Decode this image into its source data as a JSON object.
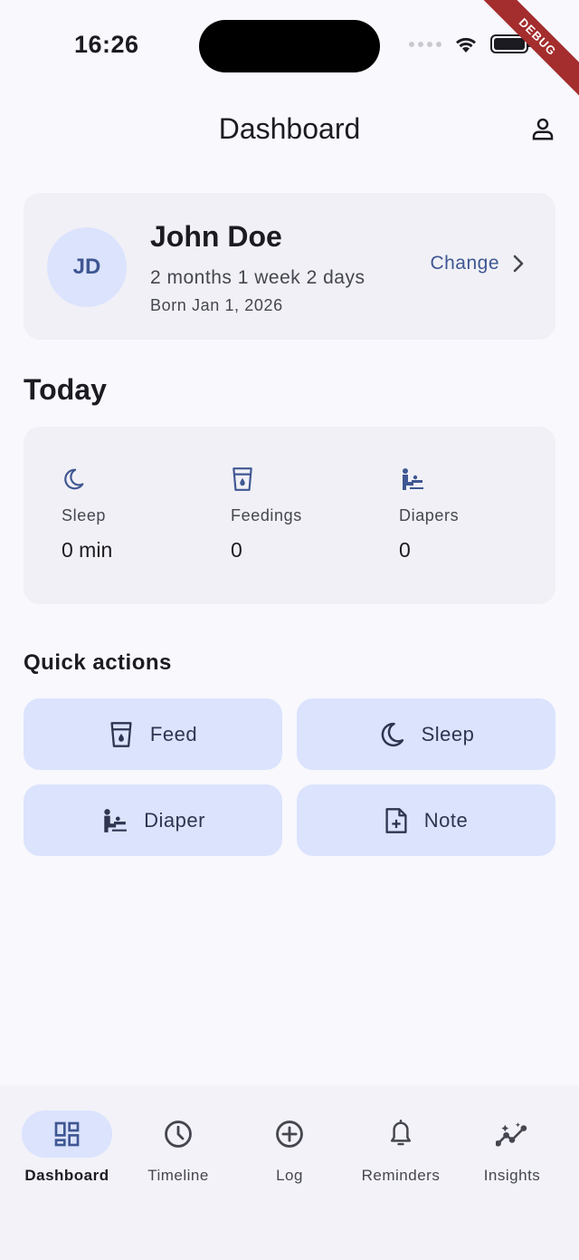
{
  "status_bar": {
    "time": "16:26",
    "debug_banner": "DEBUG"
  },
  "app_bar": {
    "title": "Dashboard",
    "profile_icon": "person-icon"
  },
  "baby": {
    "initials": "JD",
    "name": "John Doe",
    "age": "2 months 1 week 2 days",
    "born": "Born Jan 1, 2026",
    "change_label": "Change"
  },
  "today": {
    "title": "Today",
    "stats": [
      {
        "icon": "moon-icon",
        "label": "Sleep",
        "value": "0 min"
      },
      {
        "icon": "bottle-icon",
        "label": "Feedings",
        "value": "0"
      },
      {
        "icon": "diaper-icon",
        "label": "Diapers",
        "value": "0"
      }
    ]
  },
  "quick_actions": {
    "title": "Quick actions",
    "buttons": [
      {
        "icon": "bottle-icon",
        "label": "Feed"
      },
      {
        "icon": "moon-icon",
        "label": "Sleep"
      },
      {
        "icon": "diaper-icon",
        "label": "Diaper"
      },
      {
        "icon": "note-add-icon",
        "label": "Note"
      }
    ]
  },
  "bottom_nav": {
    "items": [
      {
        "icon": "dashboard-icon",
        "label": "Dashboard",
        "active": true
      },
      {
        "icon": "clock-icon",
        "label": "Timeline"
      },
      {
        "icon": "add-circle-icon",
        "label": "Log"
      },
      {
        "icon": "bell-icon",
        "label": "Reminders"
      },
      {
        "icon": "insights-icon",
        "label": "Insights"
      }
    ]
  },
  "colors": {
    "background": "#f8f8fd",
    "card": "#f0f0f6",
    "accent": "#3f5792",
    "accent_container": "#dbe3fd",
    "text": "#1b1b21",
    "muted_text": "#45464f"
  }
}
